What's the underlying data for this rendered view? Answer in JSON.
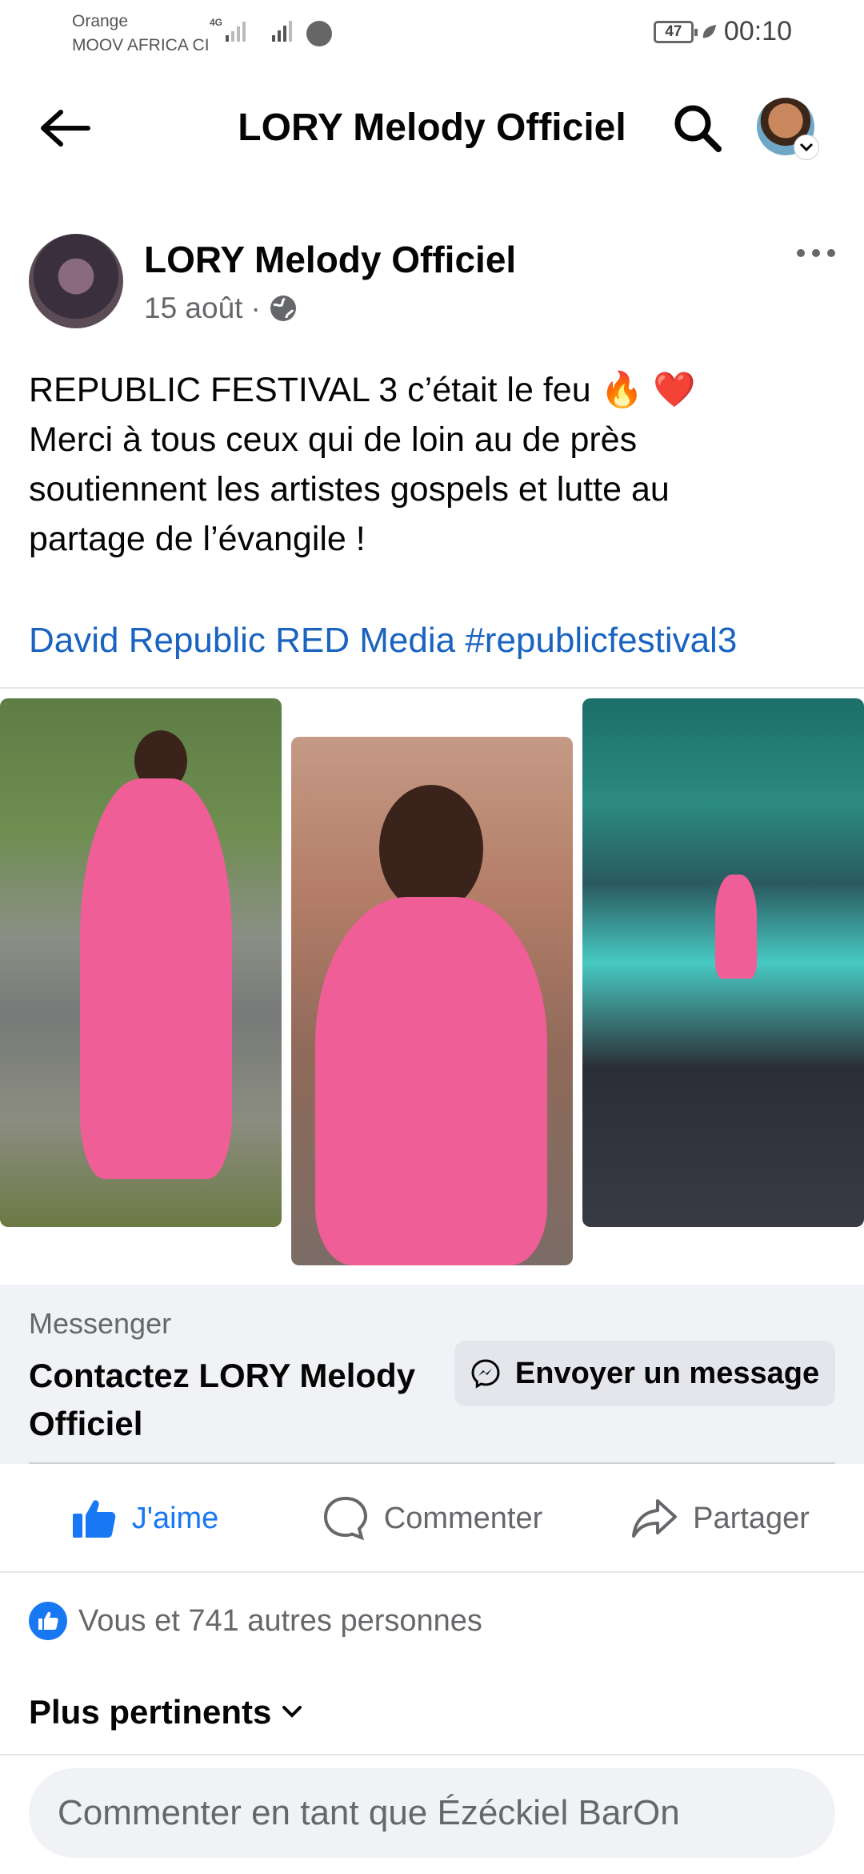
{
  "status_bar": {
    "carrier1": "Orange",
    "carrier2": "MOOV AFRICA CI",
    "network": "4G",
    "battery": "47",
    "time": "00:10"
  },
  "header": {
    "title": "LORY Melody Officiel"
  },
  "post": {
    "author": "LORY Melody Officiel",
    "date": "15 août",
    "separator": "·",
    "text_lines": [
      "REPUBLIC FESTIVAL 3 c’était le feu 🔥 ❤️",
      "Merci à tous ceux qui de loin au de près",
      "soutiennent les artistes gospels et lutte au",
      "partage de l’évangile !"
    ],
    "tags": "David Republic RED Media #republicfestival3"
  },
  "messenger": {
    "label": "Messenger",
    "contact": "Contactez LORY Melody Officiel",
    "button": "Envoyer un message"
  },
  "actions": {
    "like": "J'aime",
    "comment": "Commenter",
    "share": "Partager"
  },
  "reactions": {
    "text": "Vous et 741 autres personnes"
  },
  "sort": {
    "label": "Plus pertinents"
  },
  "comment_input": {
    "placeholder": "Commenter en tant que Ézéckiel BarOn"
  },
  "colors": {
    "accent": "#1877f2",
    "link": "#1a63c0",
    "muted": "#65676b",
    "surface": "#f0f2f5"
  }
}
